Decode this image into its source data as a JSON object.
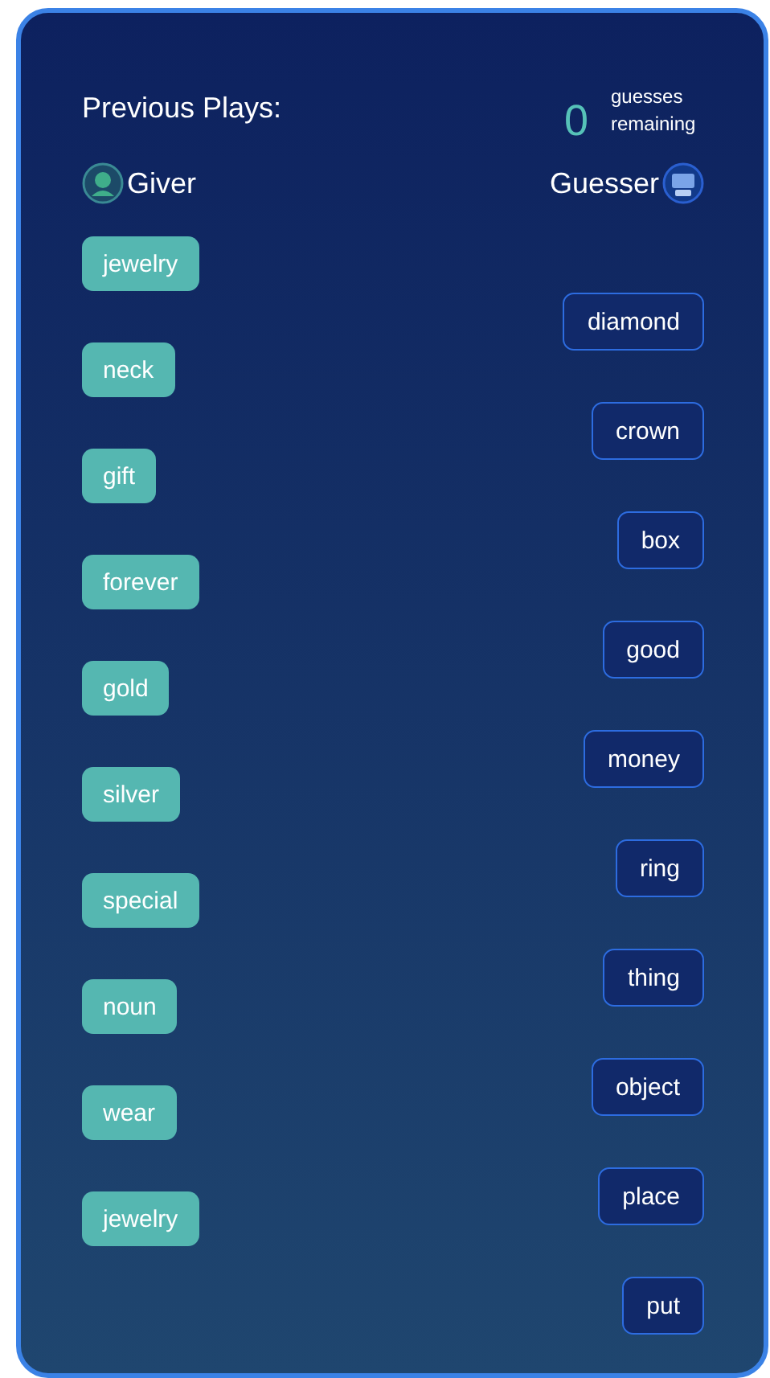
{
  "title": "Previous Plays:",
  "counter": {
    "value": "0",
    "label": "guesses remaining"
  },
  "giver": {
    "label": "Giver"
  },
  "guesser": {
    "label": "Guesser"
  },
  "giver_words": [
    "jewelry",
    "neck",
    "gift",
    "forever",
    "gold",
    "silver",
    "special",
    "noun",
    "wear",
    "jewelry"
  ],
  "guesser_words": [
    "diamond",
    "crown",
    "box",
    "good",
    "money",
    "ring",
    "thing",
    "object",
    "place",
    "put"
  ]
}
